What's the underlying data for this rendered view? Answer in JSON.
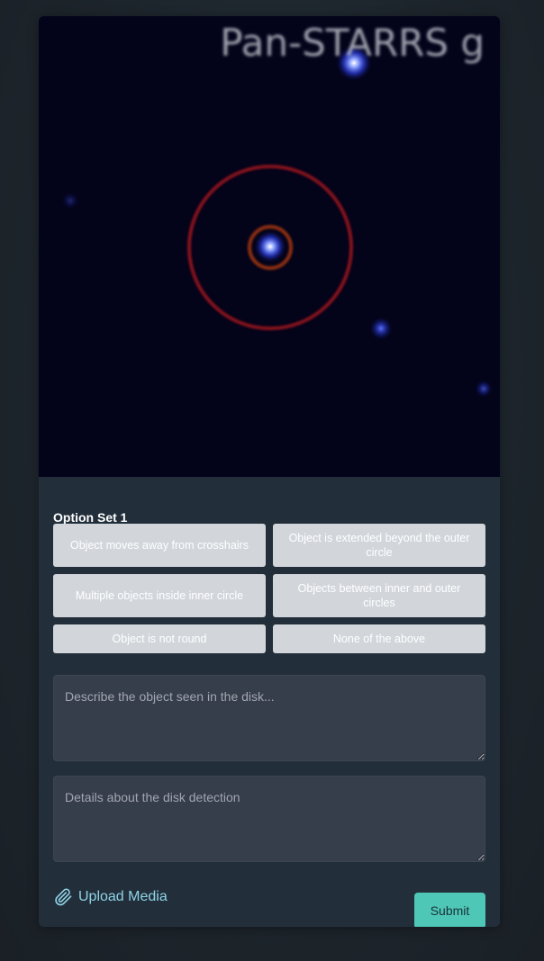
{
  "image": {
    "label": "Pan-STARRS g",
    "colors": {
      "background": "#03031a",
      "star": "#3a4dff",
      "outer_circle": "#a0141e",
      "inner_circle": "#b33a10"
    }
  },
  "option_set": {
    "title": "Option Set 1",
    "options": [
      "Object moves away from crosshairs",
      "Object is extended beyond the outer circle",
      "Multiple objects inside inner circle",
      "Objects between inner and outer circles",
      "Object is not round",
      "None of the above"
    ]
  },
  "form": {
    "description_placeholder": "Describe the object seen in the disk...",
    "details_placeholder": "Details about the disk detection",
    "upload_label": "Upload Media",
    "upload_icon": "paperclip-icon",
    "submit_label": "Submit"
  },
  "colors": {
    "accent": "#4fc7b7",
    "link": "#8fd3e6",
    "option_bg": "#d2d6db",
    "card_bg": "#222f3b"
  }
}
